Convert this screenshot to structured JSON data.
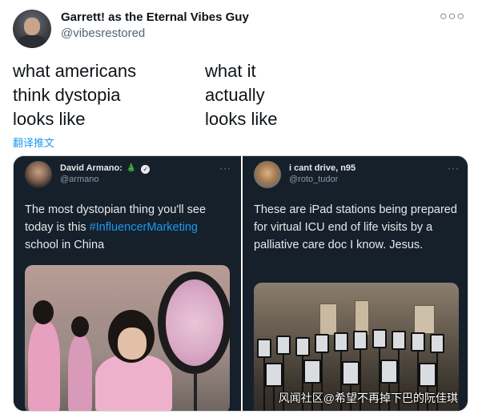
{
  "tweet": {
    "display_name": "Garrett! as the Eternal Vibes Guy",
    "handle": "@vibesrestored",
    "more_icon": "ellipsis-icon",
    "left_text": "what americans\nthink dystopia\nlooks like",
    "right_text": "what it\nactually\nlooks like",
    "translate_label": "翻译推文"
  },
  "media": {
    "left": {
      "name": "David Armano:",
      "emoji": "🎄",
      "handle": "@armano",
      "text_before": "The most dystopian thing you'll see today is this ",
      "hashtag": "#InfluencerMarketing",
      "text_after": " school in China"
    },
    "right": {
      "name": "i cant drive, n95",
      "handle": "@roto_tudor",
      "text": "These are iPad stations being prepared for virtual ICU end of life visits by a palliative care doc I know. Jesus."
    },
    "watermark": "风闻社区@希望不再掉下巴的阮佳琪"
  },
  "colors": {
    "link": "#1d9bf0",
    "quote_bg": "#15202b",
    "text": "#0f1419",
    "muted": "#536471"
  }
}
